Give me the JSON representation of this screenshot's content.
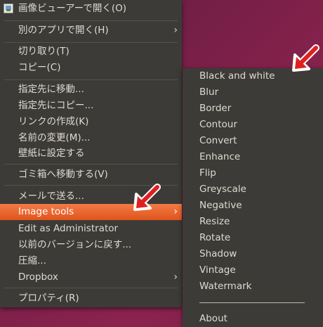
{
  "main_menu": {
    "open_with_viewer": "画像ビューアーで開く(O)",
    "open_with_other": "別のアプリで開く(H)",
    "cut": "切り取り(T)",
    "copy": "コピー(C)",
    "move_to": "指定先に移動...",
    "copy_to": "指定先にコピー...",
    "make_link": "リンクの作成(K)",
    "rename": "名前の変更(M)...",
    "set_wallpaper": "壁紙に設定する",
    "move_to_trash": "ゴミ箱へ移動する(V)",
    "send_by_mail": "メールで送る...",
    "image_tools": "Image tools",
    "edit_as_admin": "Edit as Administrator",
    "revert_version": "以前のバージョンに戻す...",
    "compress": "圧縮...",
    "dropbox": "Dropbox",
    "properties": "プロパティ(R)",
    "submenu_arrow": "›"
  },
  "image_tools_menu": {
    "items": [
      "Black and white",
      "Blur",
      "Border",
      "Contour",
      "Convert",
      "Enhance",
      "Flip",
      "Greyscale",
      "Negative",
      "Resize",
      "Rotate",
      "Shadow",
      "Vintage",
      "Watermark"
    ],
    "about": "About"
  },
  "colors": {
    "menu_bg": "#3c3b37",
    "highlight": "#e9622a",
    "annotation_arrow": "#e02020"
  }
}
